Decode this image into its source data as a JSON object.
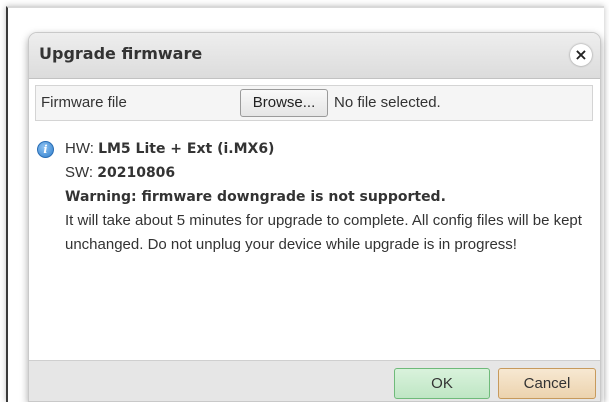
{
  "dialog": {
    "title": "Upgrade firmware",
    "close_glyph": "×"
  },
  "file_row": {
    "label": "Firmware file",
    "browse_label": "Browse...",
    "status": "No file selected."
  },
  "info": {
    "icon": "info-icon",
    "hw_prefix": "HW: ",
    "hw_value": "LM5 Lite + Ext (i.MX6)",
    "sw_prefix": "SW: ",
    "sw_value": "20210806",
    "warning": "Warning: firmware downgrade is not supported.",
    "message": "It will take about 5 minutes for upgrade to complete. All config files will be kept unchanged. Do not unplug your device while upgrade is in progress!"
  },
  "footer": {
    "ok_label": "OK",
    "cancel_label": "Cancel"
  },
  "colors": {
    "ok_bg": "#c8ebcc",
    "cancel_bg": "#f0dcbc",
    "info_icon": "#3a86d4"
  }
}
